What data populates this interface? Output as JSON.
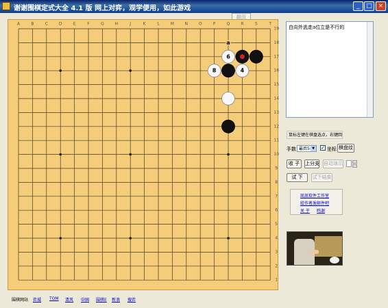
{
  "window": {
    "title": "谢谢围棋定式大全 4.1 版   网上对弈，观学便用，如此游戏",
    "controls": [
      "_",
      "□",
      "×"
    ]
  },
  "top_button": "翻页",
  "board": {
    "columns": [
      "A",
      "B",
      "C",
      "D",
      "E",
      "F",
      "G",
      "H",
      "J",
      "K",
      "L",
      "M",
      "N",
      "O",
      "P",
      "Q",
      "R",
      "S",
      "T"
    ],
    "rows": [
      "19",
      "18",
      "17",
      "16",
      "15",
      "14",
      "13",
      "12",
      "11",
      "10",
      "9",
      "8",
      "7",
      "6",
      "5",
      "4",
      "3",
      "2",
      "1"
    ],
    "star_points": [
      "D16",
      "J16",
      "Q16",
      "D10",
      "J10",
      "Q10",
      "D4",
      "J4",
      "Q4"
    ],
    "stones": [
      {
        "point": "Q17",
        "color": "white",
        "label": "6"
      },
      {
        "point": "R17",
        "color": "black",
        "label": ""
      },
      {
        "point": "S17",
        "color": "black",
        "label": ""
      },
      {
        "point": "P16",
        "color": "white",
        "label": "8"
      },
      {
        "point": "Q16",
        "color": "black",
        "label": ""
      },
      {
        "point": "R16",
        "color": "white",
        "label": "4"
      },
      {
        "point": "Q14",
        "color": "white",
        "label": ""
      },
      {
        "point": "Q12",
        "color": "black",
        "label": ""
      }
    ],
    "markers": [
      {
        "point": "Q18",
        "text": "a"
      }
    ],
    "last_move_markers": [
      "R17"
    ]
  },
  "comment": {
    "text": "白向外逃走a位立是不行的"
  },
  "hint": "鼠标左键在棋盘选点，右键回退",
  "controls": {
    "move_label": "手数",
    "move_select": "最后5手",
    "show_label": "坐标",
    "board_button": "棋盘纹",
    "btn_collect": "收 子",
    "btn_prev": "上分支",
    "btn_auto": "自动演示",
    "btn_try": "试 下",
    "btn_end_try": "试下结束"
  },
  "links": {
    "studio": "凯凯软件工作室",
    "friends": "给作者发邮件吧",
    "about": "关 于",
    "thanks": "鸣谢"
  },
  "statusbar": {
    "label": "围棋网站",
    "links": [
      "弈城",
      "TOM",
      "清风",
      "中国",
      "围棋E",
      "新浪",
      "搜弈"
    ]
  }
}
